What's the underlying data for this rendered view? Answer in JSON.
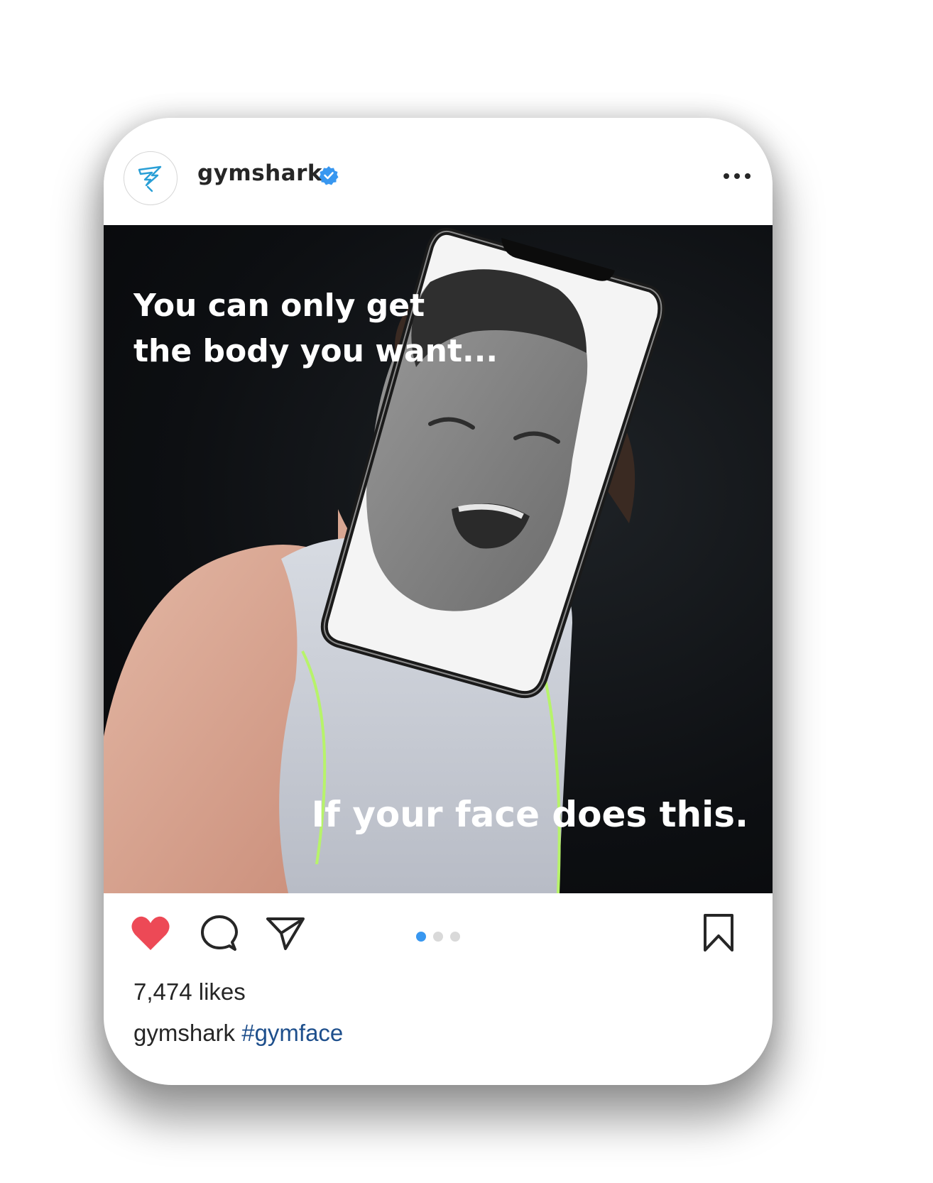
{
  "post": {
    "username": "gymshark",
    "verified": true,
    "more_icon": "more-horizontal-icon",
    "image": {
      "caption_top": "You can only get\nthe body you want...",
      "caption_bottom": "If your face does this.",
      "description": "man in gray tank top with crying face framed by phone outline"
    },
    "actions": {
      "like_icon": "heart-filled-icon",
      "comment_icon": "comment-bubble-icon",
      "share_icon": "paper-plane-icon",
      "save_icon": "bookmark-icon",
      "carousel": {
        "count": 3,
        "active_index": 0
      }
    },
    "likes": "7,474 likes",
    "caption": {
      "username": "gymshark",
      "hashtag": "#gymface"
    }
  },
  "colors": {
    "like_red": "#ed4956",
    "verified_blue": "#3897f0",
    "hashtag_blue": "#1e4f8c",
    "text_dark": "#262626",
    "brand_logo": "#2a9fd6"
  }
}
